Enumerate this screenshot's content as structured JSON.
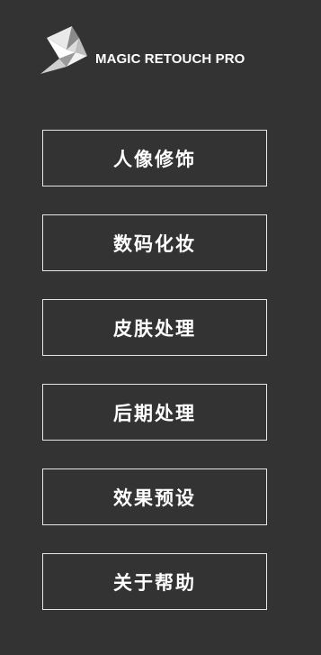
{
  "brand": {
    "logo_icon": "origami-bird-icon",
    "name": "MAGIC RETOUCH PRO"
  },
  "menu": {
    "items": [
      {
        "label": "人像修饰"
      },
      {
        "label": "数码化妆"
      },
      {
        "label": "皮肤处理"
      },
      {
        "label": "后期处理"
      },
      {
        "label": "效果预设"
      },
      {
        "label": "关于帮助"
      }
    ]
  },
  "colors": {
    "background": "#333333",
    "button_border": "#e6e6e6",
    "text": "#ffffff"
  }
}
